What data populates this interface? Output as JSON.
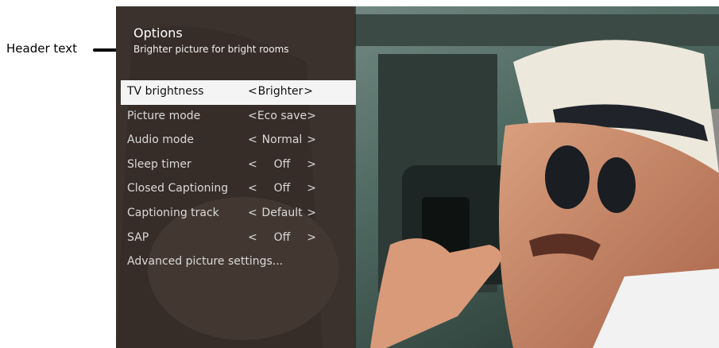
{
  "callout": {
    "label": "Header text"
  },
  "options": {
    "title": "Options",
    "subtitle": "Brighter picture for bright rooms",
    "items": [
      {
        "label": "TV brightness",
        "value": "Brighter",
        "left_arrow": "<",
        "right_arrow": ">",
        "selected": true
      },
      {
        "label": "Picture mode",
        "value": "Eco save",
        "left_arrow": "<",
        "right_arrow": ">"
      },
      {
        "label": "Audio mode",
        "value": "Normal",
        "left_arrow": "<",
        "right_arrow": ">"
      },
      {
        "label": "Sleep timer",
        "value": "Off",
        "left_arrow": "<",
        "right_arrow": ">"
      },
      {
        "label": "Closed Captioning",
        "value": "Off",
        "left_arrow": "<",
        "right_arrow": ">"
      },
      {
        "label": "Captioning track",
        "value": "Default",
        "left_arrow": "<",
        "right_arrow": ">"
      },
      {
        "label": "SAP",
        "value": "Off",
        "left_arrow": "<",
        "right_arrow": ">"
      },
      {
        "label": "Advanced picture settings..."
      }
    ]
  },
  "colors": {
    "panel_overlay": "#282624",
    "selected_row": "#f4f4f4",
    "menu_text": "#d9d9d9"
  }
}
